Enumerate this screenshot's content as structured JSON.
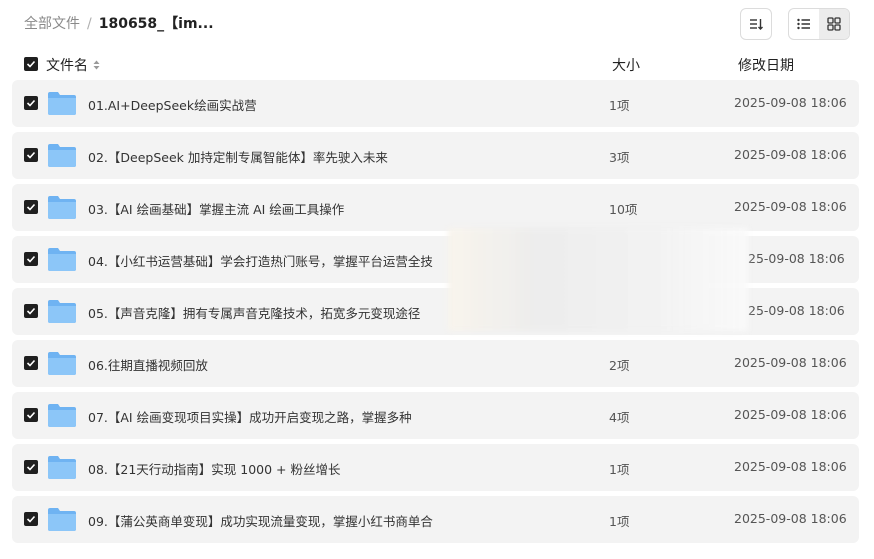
{
  "breadcrumb": {
    "root": "全部文件",
    "separator": "/",
    "current": "180658_【im..."
  },
  "toolbar": {
    "sort_icon": "sort-lines-icon",
    "list_view_icon": "list-view-icon",
    "grid_view_icon": "grid-view-icon",
    "active_view": "grid"
  },
  "columns": {
    "name": "文件名",
    "size": "大小",
    "modified": "修改日期"
  },
  "rows": [
    {
      "name": "01.AI+DeepSeek绘画实战营",
      "size": "1项",
      "date": "2025-09-08 18:06"
    },
    {
      "name": "02.【DeepSeek 加持定制专属智能体】率先驶入未来",
      "size": "3项",
      "date": "2025-09-08 18:06"
    },
    {
      "name": "03.【AI 绘画基础】掌握主流 AI 绘画工具操作",
      "size": "10项",
      "date": "2025-09-08 18:06"
    },
    {
      "name": "04.【小红书运营基础】学会打造热门账号，掌握平台运营全技",
      "size": "",
      "date": "25-09-08 18:06"
    },
    {
      "name": "05.【声音克隆】拥有专属声音克隆技术，拓宽多元变现途径",
      "size": "",
      "date": "25-09-08 18:06"
    },
    {
      "name": "06.往期直播视频回放",
      "size": "2项",
      "date": "2025-09-08 18:06"
    },
    {
      "name": "07.【AI 绘画变现项目实操】成功开启变现之路，掌握多种",
      "size": "4项",
      "date": "2025-09-08 18:06"
    },
    {
      "name": "08.【21天行动指南】实现 1000 + 粉丝增长",
      "size": "1项",
      "date": "2025-09-08 18:06"
    },
    {
      "name": "09.【蒲公英商单变现】成功实现流量变现，掌握小红书商单合",
      "size": "1项",
      "date": "2025-09-08 18:06"
    }
  ],
  "colors": {
    "row_bg": "#f3f3f3",
    "checkbox": "#1f1f1f",
    "folder": "#6fb3f2"
  }
}
